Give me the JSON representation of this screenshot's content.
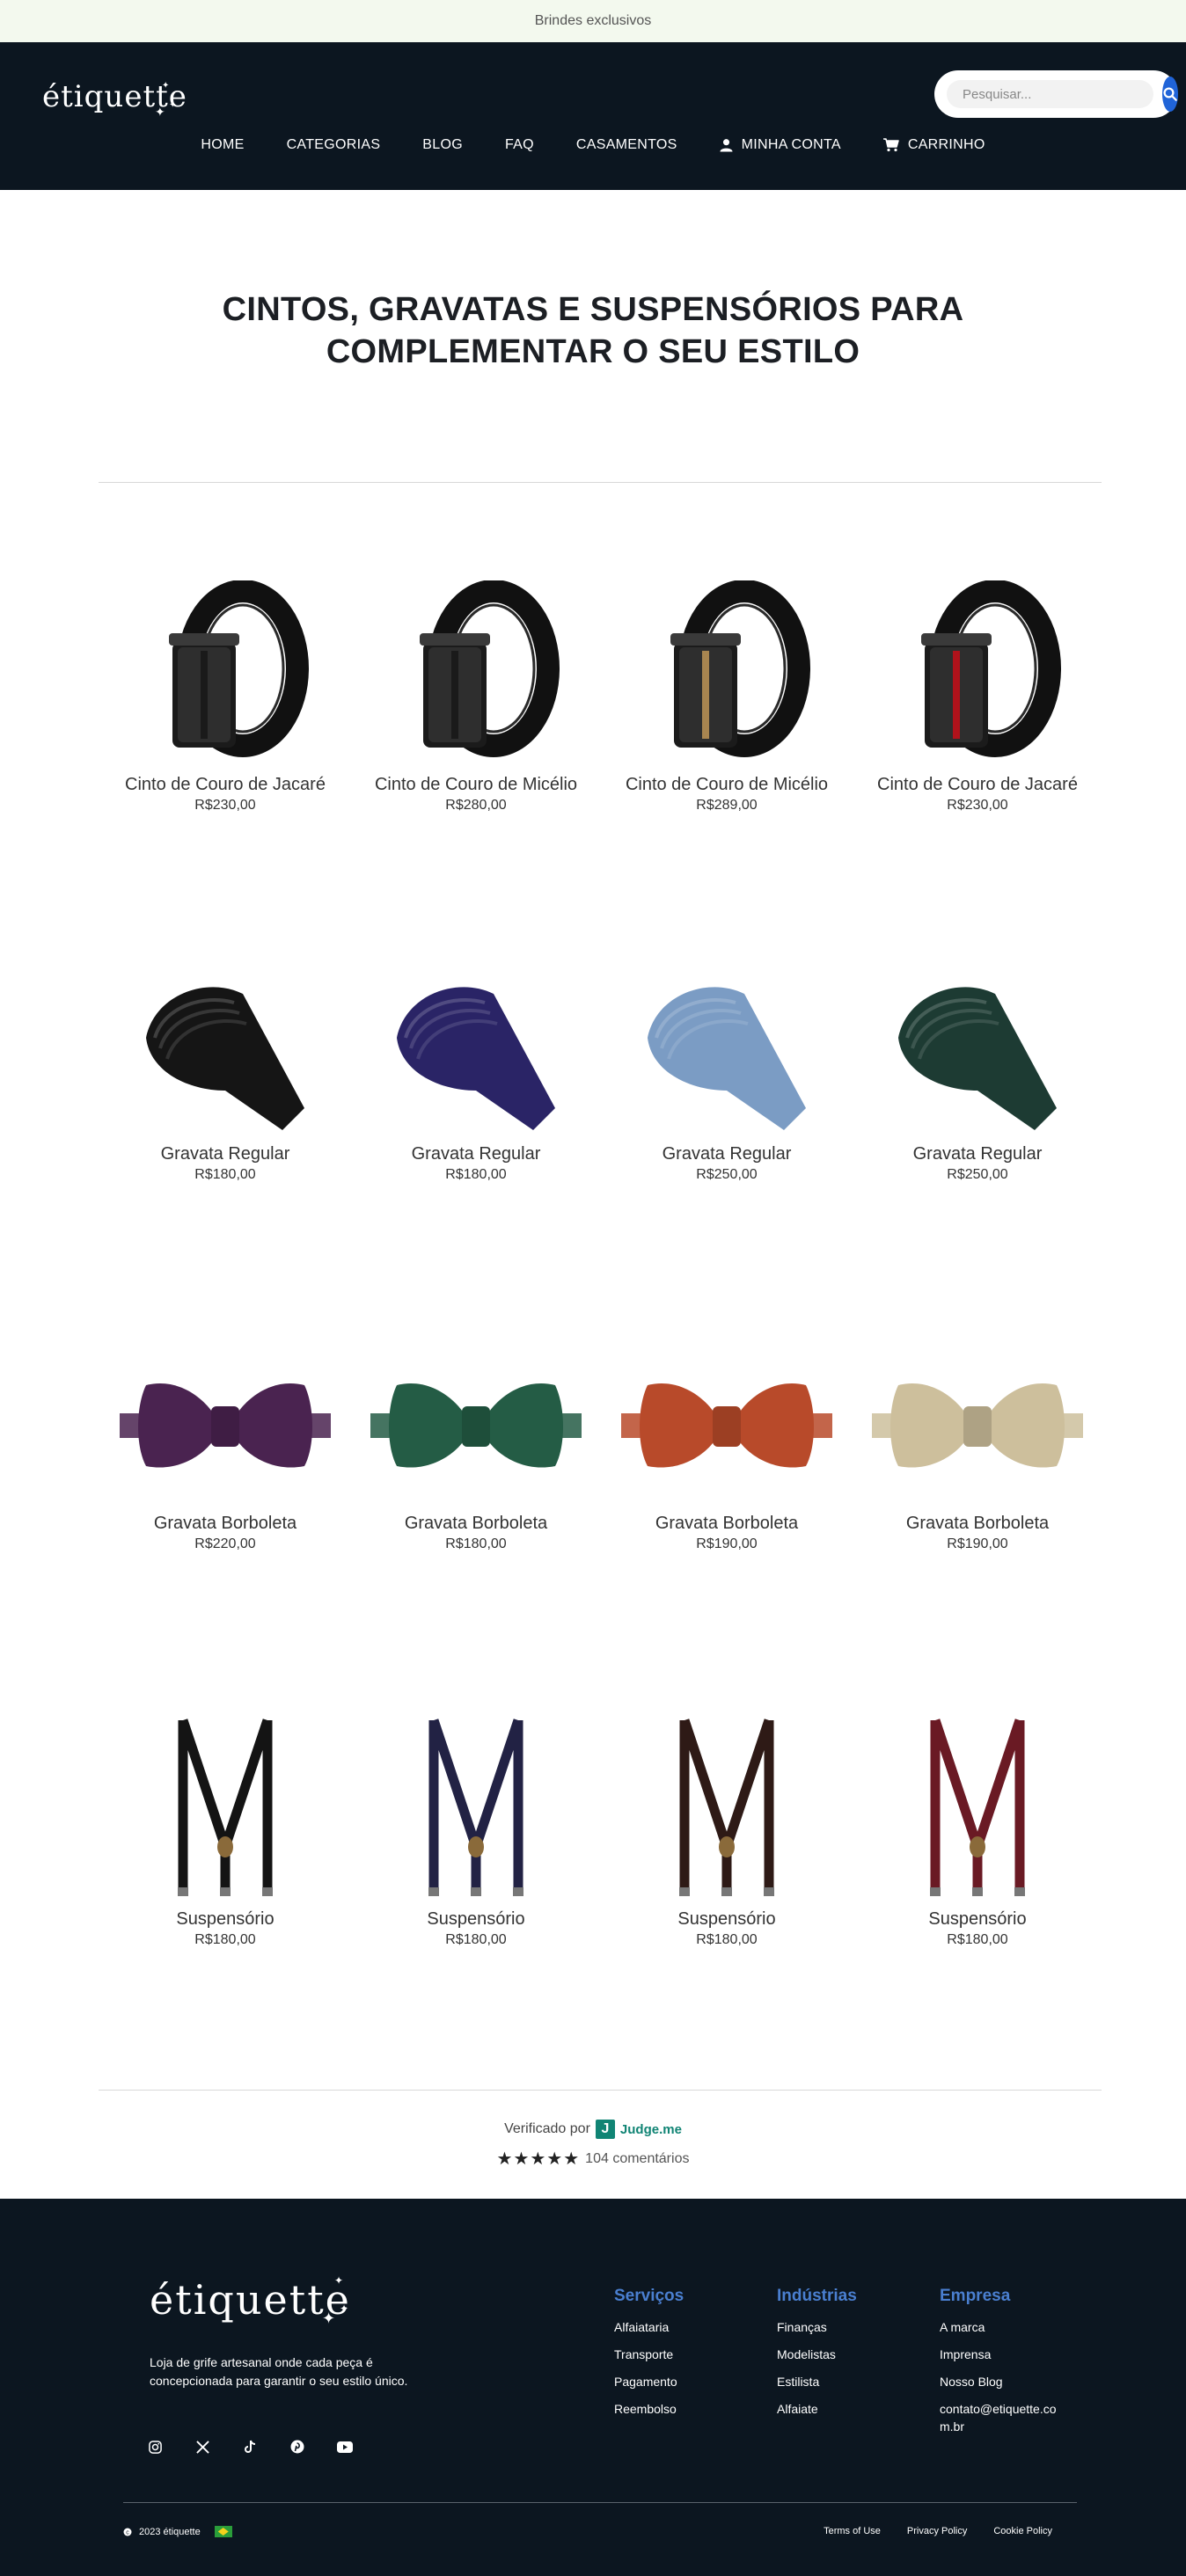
{
  "announcement": "Brindes exclusivos",
  "brand": "étiquette",
  "search": {
    "placeholder": "Pesquisar..."
  },
  "nav": [
    {
      "label": "HOME",
      "icon": ""
    },
    {
      "label": "CATEGORIAS",
      "icon": ""
    },
    {
      "label": "BLOG",
      "icon": ""
    },
    {
      "label": "FAQ",
      "icon": ""
    },
    {
      "label": "CASAMENTOS",
      "icon": ""
    },
    {
      "label": "MINHA CONTA",
      "icon": "user-icon"
    },
    {
      "label": "CARRINHO",
      "icon": "cart-icon"
    }
  ],
  "page_title": "CINTOS, GRAVATAS E SUSPENSÓRIOS PARA COMPLEMENTAR O SEU ESTILO",
  "products": [
    {
      "name": "Cinto de Couro de Jacaré",
      "price": "R$230,00",
      "kind": "belt",
      "accent": "#1a1a1a"
    },
    {
      "name": "Cinto de Couro de Micélio",
      "price": "R$280,00",
      "kind": "belt",
      "accent": "#1a1a1a"
    },
    {
      "name": "Cinto de Couro de Micélio",
      "price": "R$289,00",
      "kind": "belt",
      "accent": "#a88550"
    },
    {
      "name": "Cinto de Couro de Jacaré",
      "price": "R$230,00",
      "kind": "belt",
      "accent": "#b0121b"
    },
    {
      "name": "Gravata Regular",
      "price": "R$180,00",
      "kind": "tie",
      "accent": "#151515"
    },
    {
      "name": "Gravata Regular",
      "price": "R$180,00",
      "kind": "tie",
      "accent": "#2a2466"
    },
    {
      "name": "Gravata Regular",
      "price": "R$250,00",
      "kind": "tie",
      "accent": "#7b9cc4"
    },
    {
      "name": "Gravata Regular",
      "price": "R$250,00",
      "kind": "tie",
      "accent": "#1d3b33"
    },
    {
      "name": "Gravata Borboleta",
      "price": "R$220,00",
      "kind": "bowtie",
      "accent": "#4a2350"
    },
    {
      "name": "Gravata Borboleta",
      "price": "R$180,00",
      "kind": "bowtie",
      "accent": "#245c45"
    },
    {
      "name": "Gravata Borboleta",
      "price": "R$190,00",
      "kind": "bowtie",
      "accent": "#b84a2a"
    },
    {
      "name": "Gravata Borboleta",
      "price": "R$190,00",
      "kind": "bowtie",
      "accent": "#cdbf9c"
    },
    {
      "name": "Suspensório",
      "price": "R$180,00",
      "kind": "suspender",
      "accent": "#141414"
    },
    {
      "name": "Suspensório",
      "price": "R$180,00",
      "kind": "suspender",
      "accent": "#222244"
    },
    {
      "name": "Suspensório",
      "price": "R$180,00",
      "kind": "suspender",
      "accent": "#2e1a16"
    },
    {
      "name": "Suspensório",
      "price": "R$180,00",
      "kind": "suspender",
      "accent": "#6a1a24"
    }
  ],
  "reviews": {
    "verified_label": "Verificado por",
    "provider_badge": "J",
    "provider": "Judge.me",
    "stars": "★★★★★",
    "count_label": "104 comentários"
  },
  "footer": {
    "brand": "étiquette",
    "description": "Loja de grife artesanal onde cada peça é concepcionada para garantir o seu estilo único.",
    "socials": [
      "instagram-icon",
      "x-icon",
      "tiktok-icon",
      "pinterest-icon",
      "youtube-icon"
    ],
    "columns": [
      {
        "title": "Serviços",
        "links": [
          "Alfaiataria",
          "Transporte",
          "Pagamento",
          "Reembolso"
        ]
      },
      {
        "title": "Indústrias",
        "links": [
          "Finanças",
          "Modelistas",
          "Estilista",
          "Alfaiate"
        ]
      },
      {
        "title": "Empresa",
        "links": [
          "A marca",
          "Imprensa",
          "Nosso Blog",
          "contato@etiquette.co m.br"
        ]
      }
    ],
    "copyright": "2023 étiquette",
    "legal": [
      "Terms of Use",
      "Privacy Policy",
      "Cookie Policy"
    ]
  },
  "colors": {
    "header_bg": "#0c1620",
    "accent_blue": "#2064d8",
    "footer_heading": "#4a7fd0"
  }
}
